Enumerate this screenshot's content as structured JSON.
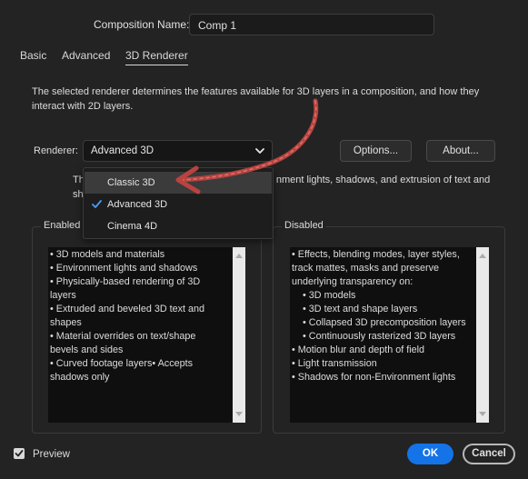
{
  "composition": {
    "label": "Composition Name:",
    "value": "Comp 1"
  },
  "tabs": [
    {
      "label": "Basic"
    },
    {
      "label": "Advanced"
    },
    {
      "label": "3D Renderer"
    }
  ],
  "description": "The selected renderer determines the features available for 3D layers in a composition, and how they interact with 2D layers.",
  "renderer": {
    "label": "Renderer:",
    "selected": "Advanced 3D",
    "options_button": "Options...",
    "about_button": "About..."
  },
  "renderer_desc_visible": {
    "line1_start": "Th",
    "line1_end": "nment lights, shadows, and extrusion of text and",
    "line2_start": "sh"
  },
  "dropdown": {
    "items": [
      {
        "label": "Classic 3D",
        "checked": false,
        "hovered": true
      },
      {
        "label": "Advanced 3D",
        "checked": true,
        "hovered": false
      },
      {
        "label": "Cinema 4D",
        "checked": false,
        "hovered": false
      }
    ]
  },
  "enabled": {
    "title": "Enabled",
    "lines": [
      "• 3D models and materials",
      "• Environment lights and shadows",
      "• Physically-based rendering of 3D",
      "layers",
      "• Extruded and beveled 3D text and",
      "shapes",
      "• Material overrides on text/shape",
      "bevels and sides",
      "• Curved footage layers• Accepts",
      "shadows only"
    ]
  },
  "disabled": {
    "title": "Disabled",
    "lines": [
      "• Effects, blending modes, layer styles,",
      "track mattes, masks and preserve",
      "underlying transparency on:",
      "    • 3D models",
      "    • 3D text and shape layers",
      "    • Collapsed 3D precomposition layers",
      "    • Continuously rasterized 3D layers",
      "• Motion blur and depth of field",
      "• Light transmission",
      "• Shadows for non-Environment lights"
    ]
  },
  "footer": {
    "preview_label": "Preview",
    "preview_checked": true,
    "ok_label": "OK",
    "cancel_label": "Cancel"
  },
  "colors": {
    "accent": "#1473e6",
    "annotation_arrow": "#c0504d"
  }
}
